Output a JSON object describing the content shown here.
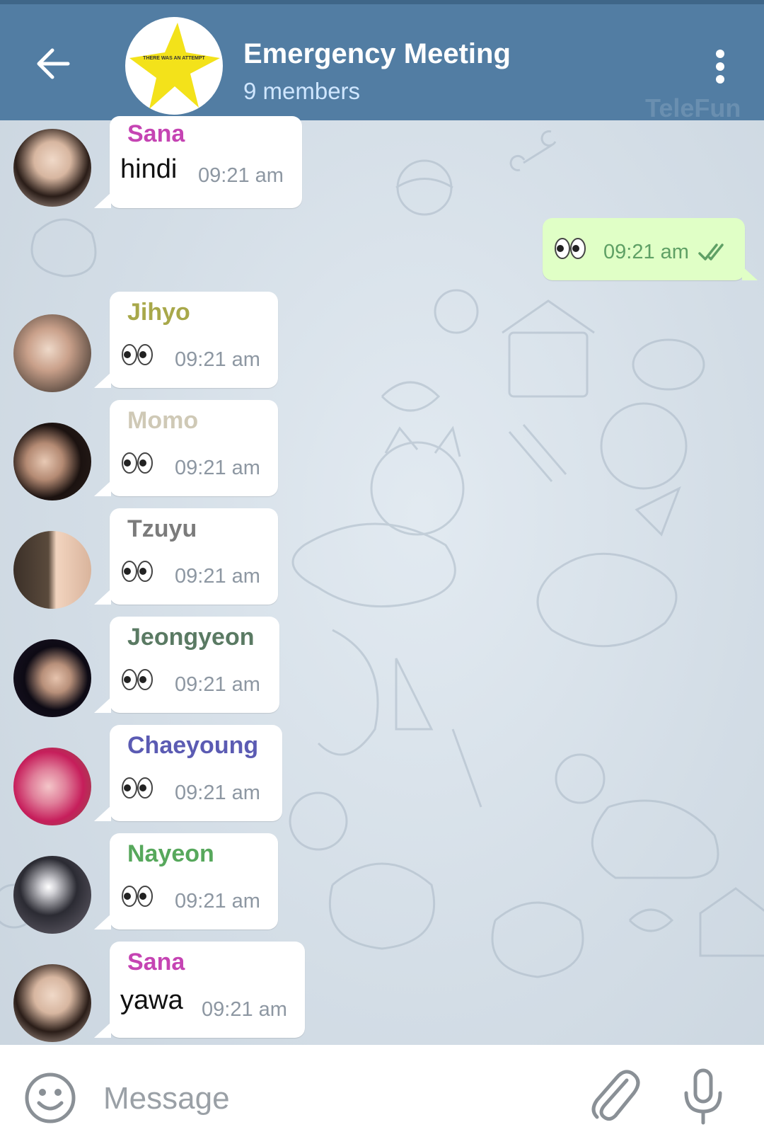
{
  "header": {
    "title": "Emergency Meeting",
    "subtitle": "9 members",
    "avatar_text": "THERE WAS AN ATTEMPT",
    "watermark": "TeleFun"
  },
  "messages": [
    {
      "sender": "Sana",
      "sender_color": "#c544b3",
      "text": "hindi",
      "time": "09:21 am"
    },
    {
      "sender": "Jihyo",
      "sender_color": "#a8a84a",
      "time": "09:21 am"
    },
    {
      "sender": "Momo",
      "sender_color": "#cfc9b6",
      "time": "09:21 am"
    },
    {
      "sender": "Tzuyu",
      "sender_color": "#7b7b7b",
      "time": "09:21 am"
    },
    {
      "sender": "Jeongyeon",
      "sender_color": "#5a7a63",
      "time": "09:21 am"
    },
    {
      "sender": "Chaeyoung",
      "sender_color": "#5b5bb3",
      "time": "09:21 am"
    },
    {
      "sender": "Nayeon",
      "sender_color": "#57a85c",
      "time": "09:21 am"
    },
    {
      "sender": "Sana",
      "sender_color": "#c544b3",
      "text": "yawa",
      "time": "09:21 am"
    }
  ],
  "outgoing": {
    "time": "09:21 am",
    "status": "read",
    "check_color": "#5fa065"
  },
  "input": {
    "placeholder": "Message"
  },
  "icons": {
    "back": "arrow-left-icon",
    "menu": "more-vertical-icon",
    "emoji": "smiley-icon",
    "attach": "paperclip-icon",
    "mic": "microphone-icon",
    "eyes": "eyes-emoji-icon",
    "check": "double-check-icon"
  },
  "colors": {
    "header": "#527da3",
    "outgoing_bubble": "#e0ffc6",
    "incoming_bubble": "#ffffff"
  }
}
